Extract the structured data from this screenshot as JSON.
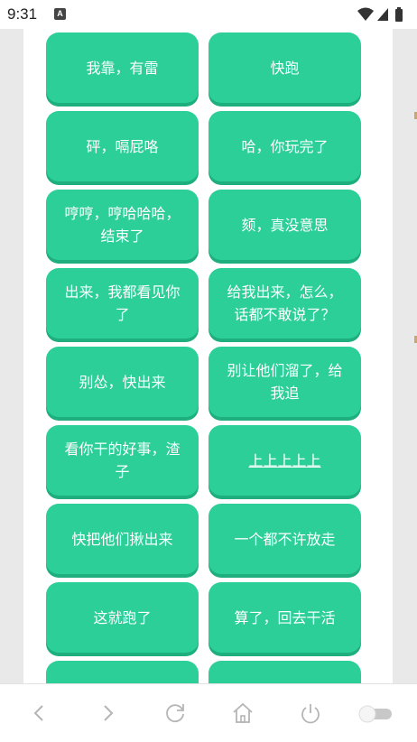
{
  "status_bar": {
    "time": "9:31",
    "notification_icon": "A"
  },
  "buttons": [
    {
      "label": "我靠，有雷"
    },
    {
      "label": "快跑"
    },
    {
      "label": "砰，嗝屁咯"
    },
    {
      "label": "哈，你玩完了"
    },
    {
      "label": "哼哼，哼哈哈哈，结束了"
    },
    {
      "label": "颏，真没意思"
    },
    {
      "label": "出来，我都看见你了"
    },
    {
      "label": "给我出来，怎么，话都不敢说了？"
    },
    {
      "label": "别怂，快出来"
    },
    {
      "label": "别让他们溜了，给我追"
    },
    {
      "label": "看你干的好事，渣子"
    },
    {
      "label": "上上上上上"
    },
    {
      "label": "快把他们揪出来"
    },
    {
      "label": "一个都不许放走"
    },
    {
      "label": "这就跑了"
    },
    {
      "label": "算了，回去干活"
    },
    {
      "label": ""
    },
    {
      "label": ""
    }
  ],
  "nav": {
    "icons": [
      "back-icon",
      "forward-icon",
      "refresh-icon",
      "home-icon",
      "power-icon",
      "toggle-switch"
    ]
  },
  "colors": {
    "button": "#2bcf97",
    "button_shadow": "#1fae7d"
  }
}
